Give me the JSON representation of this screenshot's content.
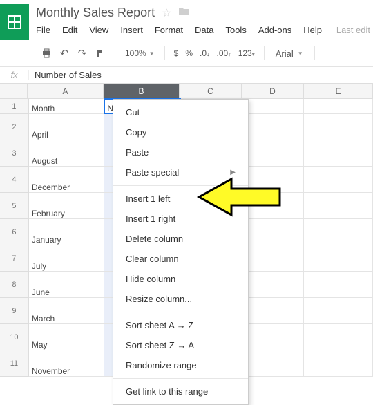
{
  "doc": {
    "title": "Monthly Sales Report",
    "last_edit": "Last edit"
  },
  "menubar": [
    "File",
    "Edit",
    "View",
    "Insert",
    "Format",
    "Data",
    "Tools",
    "Add-ons",
    "Help"
  ],
  "toolbar": {
    "zoom": "100%",
    "font": "Arial"
  },
  "fx": {
    "value": "Number of Sales"
  },
  "columns": [
    "A",
    "B",
    "C",
    "D",
    "E"
  ],
  "selected_col": "B",
  "rows": [
    {
      "n": "1",
      "a": "Month",
      "b": "Num"
    },
    {
      "n": "2",
      "a": "April",
      "b": ""
    },
    {
      "n": "3",
      "a": "August",
      "b": ""
    },
    {
      "n": "4",
      "a": "December",
      "b": ""
    },
    {
      "n": "5",
      "a": "February",
      "b": ""
    },
    {
      "n": "6",
      "a": "January",
      "b": ""
    },
    {
      "n": "7",
      "a": "July",
      "b": ""
    },
    {
      "n": "8",
      "a": "June",
      "b": ""
    },
    {
      "n": "9",
      "a": "March",
      "b": ""
    },
    {
      "n": "10",
      "a": "May",
      "b": ""
    },
    {
      "n": "11",
      "a": "November",
      "b": ""
    }
  ],
  "context_menu": {
    "grp1": [
      "Cut",
      "Copy",
      "Paste"
    ],
    "paste_special": "Paste special",
    "grp2": [
      "Insert 1 left",
      "Insert 1 right",
      "Delete column",
      "Clear column",
      "Hide column",
      "Resize column..."
    ],
    "grp3": [
      "Sort sheet A → Z",
      "Sort sheet Z → A",
      "Randomize range"
    ],
    "grp4": [
      "Get link to this range"
    ]
  }
}
